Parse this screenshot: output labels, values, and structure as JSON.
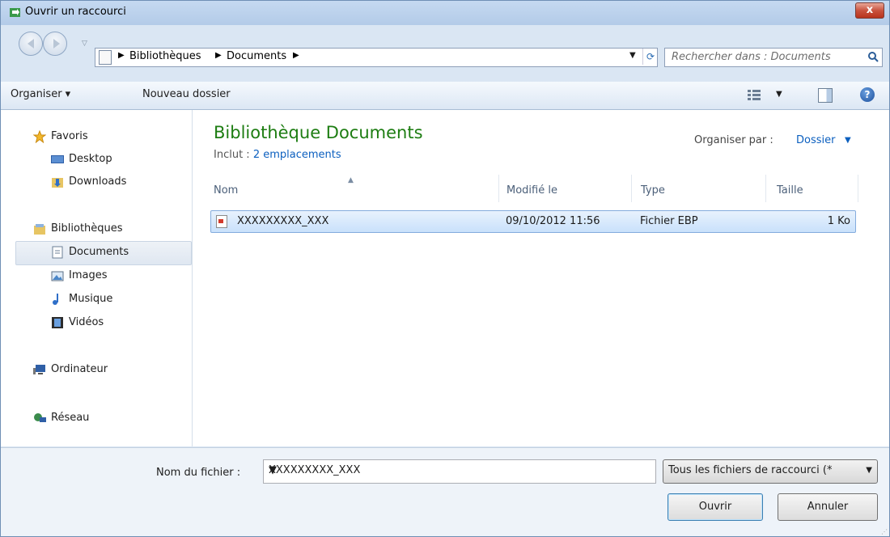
{
  "window": {
    "title": "Ouvrir un raccourci",
    "close_label": "x"
  },
  "address": {
    "breadcrumbs": [
      "Bibliothèques",
      "Documents"
    ],
    "search_placeholder": "Rechercher dans : Documents"
  },
  "toolbar": {
    "organize": "Organiser ▾",
    "new_folder": "Nouveau dossier",
    "help": "?"
  },
  "nav": {
    "favorites": {
      "label": "Favoris",
      "items": [
        "Desktop",
        "Downloads"
      ]
    },
    "libraries": {
      "label": "Bibliothèques",
      "items": [
        "Documents",
        "Images",
        "Musique",
        "Vidéos"
      ]
    },
    "computer": "Ordinateur",
    "network": "Réseau"
  },
  "content": {
    "title": "Bibliothèque Documents",
    "includes_prefix": "Inclut : ",
    "includes_link": "2 emplacements",
    "arrange_by_label": "Organiser par :",
    "arrange_by_value": "Dossier"
  },
  "columns": [
    "Nom",
    "Modifié le",
    "Type",
    "Taille"
  ],
  "files": [
    {
      "name": "XXXXXXXXX_XXX",
      "modified": "09/10/2012 11:56",
      "type": "Fichier EBP",
      "size": "1 Ko"
    }
  ],
  "bottom": {
    "filename_label": "Nom du fichier :",
    "filename_value": "XXXXXXXXX_XXX",
    "filter_value": "Tous les fichiers de raccourci (*",
    "open_button": "Ouvrir",
    "cancel_button": "Annuler"
  },
  "colors": {
    "accent_title": "#1d7d12",
    "link": "#0b5fbf",
    "selection": "#c9e1fb"
  }
}
